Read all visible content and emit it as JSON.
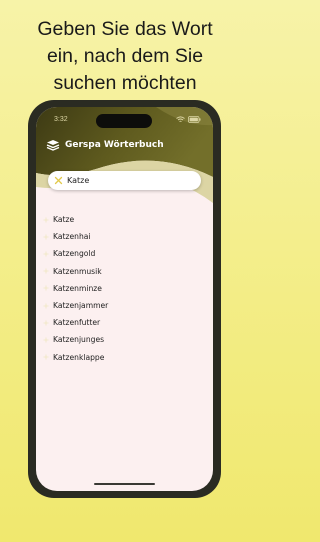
{
  "headline": {
    "lines": [
      "Geben Sie das Wort",
      "ein, nach dem Sie",
      "suchen möchten"
    ]
  },
  "status_bar": {
    "time": "3:32"
  },
  "app": {
    "title": "Gerspa Wörterbuch"
  },
  "search": {
    "value": "Katze"
  },
  "results": [
    {
      "label": "Katze"
    },
    {
      "label": "Katzenhai"
    },
    {
      "label": "Katzengold"
    },
    {
      "label": "Katzenmusik"
    },
    {
      "label": "Katzenminze"
    },
    {
      "label": "Katzenjammer"
    },
    {
      "label": "Katzenfutter"
    },
    {
      "label": "Katzenjunges"
    },
    {
      "label": "Katzenklappe"
    }
  ],
  "icons": {
    "brand": "book-stack-icon",
    "clear": "close-icon",
    "result": "sparkle-icon"
  },
  "colors": {
    "background": "#f3ed86",
    "header_dark": "#5e5a1e",
    "header_light": "#dcd5a4",
    "accent": "#e8dd5a",
    "screen": "#fcf0f0"
  }
}
